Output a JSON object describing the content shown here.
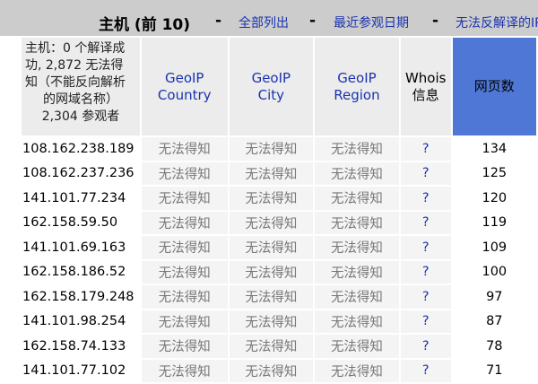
{
  "header": {
    "title": "主机 (前 10)",
    "sep": "-",
    "links": [
      "全部列出",
      "最近参观日期",
      "无法反解译的IP"
    ]
  },
  "columns": {
    "summary": {
      "line1": "主机：0 个解译成",
      "line2": "功, 2,872 无法得",
      "line3": "知（不能反向解析",
      "line4": "的网域名称）",
      "line5": "2,304 参观者"
    },
    "country": {
      "l1": "GeoIP",
      "l2": "Country"
    },
    "city": {
      "l1": "GeoIP",
      "l2": "City"
    },
    "region": {
      "l1": "GeoIP",
      "l2": "Region"
    },
    "whois": {
      "l1": "Whois",
      "l2": "信息"
    },
    "pages": "网页数"
  },
  "rows": [
    {
      "host": "108.162.238.189",
      "country": "无法得知",
      "city": "无法得知",
      "region": "无法得知",
      "whois": "?",
      "pages": "134"
    },
    {
      "host": "108.162.237.236",
      "country": "无法得知",
      "city": "无法得知",
      "region": "无法得知",
      "whois": "?",
      "pages": "125"
    },
    {
      "host": "141.101.77.234",
      "country": "无法得知",
      "city": "无法得知",
      "region": "无法得知",
      "whois": "?",
      "pages": "120"
    },
    {
      "host": "162.158.59.50",
      "country": "无法得知",
      "city": "无法得知",
      "region": "无法得知",
      "whois": "?",
      "pages": "119"
    },
    {
      "host": "141.101.69.163",
      "country": "无法得知",
      "city": "无法得知",
      "region": "无法得知",
      "whois": "?",
      "pages": "109"
    },
    {
      "host": "162.158.186.52",
      "country": "无法得知",
      "city": "无法得知",
      "region": "无法得知",
      "whois": "?",
      "pages": "100"
    },
    {
      "host": "162.158.179.248",
      "country": "无法得知",
      "city": "无法得知",
      "region": "无法得知",
      "whois": "?",
      "pages": "97"
    },
    {
      "host": "141.101.98.254",
      "country": "无法得知",
      "city": "无法得知",
      "region": "无法得知",
      "whois": "?",
      "pages": "87"
    },
    {
      "host": "162.158.74.133",
      "country": "无法得知",
      "city": "无法得知",
      "region": "无法得知",
      "whois": "?",
      "pages": "78"
    },
    {
      "host": "141.101.77.102",
      "country": "无法得知",
      "city": "无法得知",
      "region": "无法得知",
      "whois": "?",
      "pages": "71"
    }
  ],
  "colors": {
    "header_bg": "#cccccc",
    "link": "#1a33b0",
    "sorted_column": "#4f78d6",
    "unknown_text": "#777777"
  }
}
